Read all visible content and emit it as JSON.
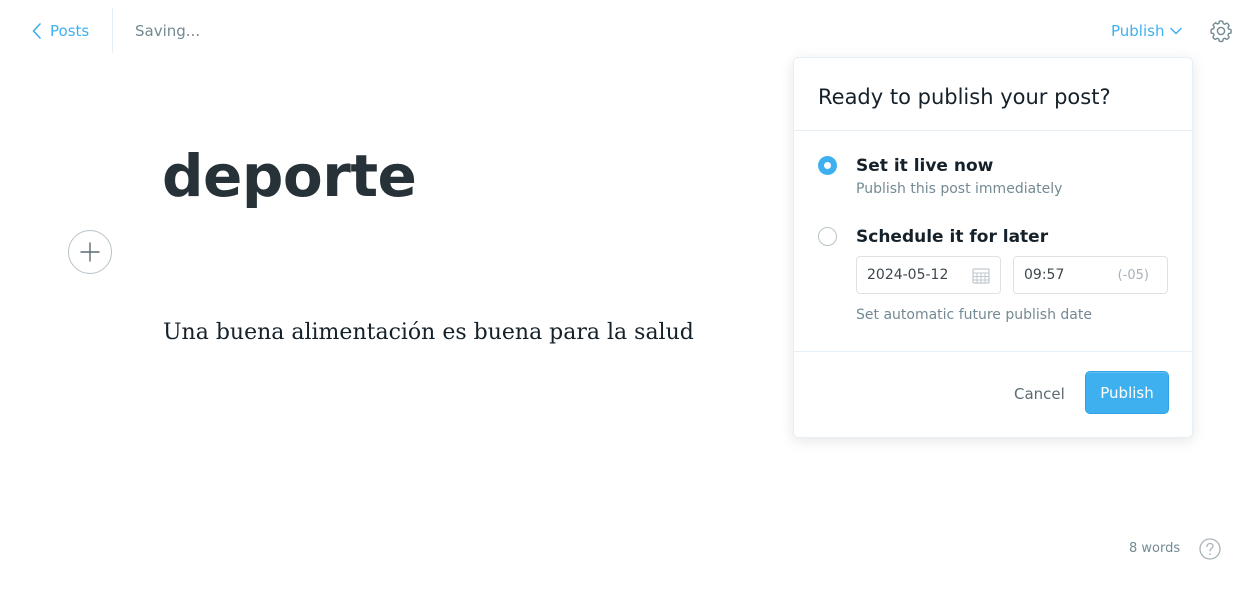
{
  "topbar": {
    "back_label": "Posts",
    "status": "Saving...",
    "publish_menu_label": "Publish"
  },
  "editor": {
    "title": "deporte",
    "body": "Una buena alimentación es buena para la salud"
  },
  "publish_popover": {
    "heading": "Ready to publish your post?",
    "options": [
      {
        "title": "Set it live now",
        "description": "Publish this post immediately",
        "selected": true
      },
      {
        "title": "Schedule it for later",
        "description": "Set automatic future publish date",
        "selected": false
      }
    ],
    "date_value": "2024-05-12",
    "time_value": "09:57",
    "timezone": "(-05)",
    "cancel_label": "Cancel",
    "publish_label": "Publish"
  },
  "footer": {
    "word_count": "8 words"
  },
  "colors": {
    "accent": "#3eb0ef",
    "text": "#15212a",
    "muted": "#738a94"
  },
  "icons": {
    "back": "chevron-left-icon",
    "publish_menu": "chevron-down-icon",
    "settings": "gear-icon",
    "add": "plus-icon",
    "date": "calendar-icon",
    "help": "question-icon"
  }
}
